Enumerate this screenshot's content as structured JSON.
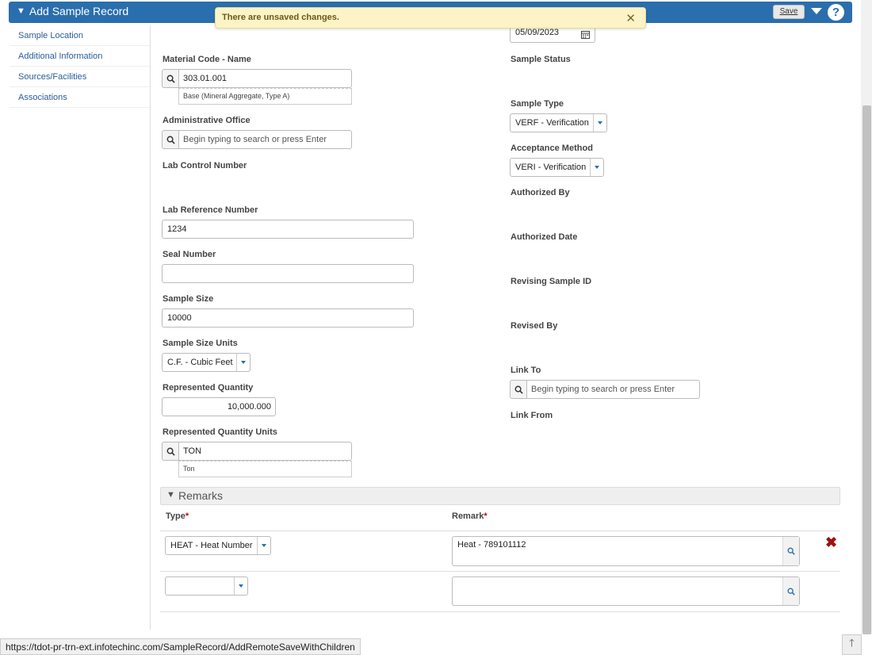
{
  "header": {
    "title": "Add Sample Record",
    "save_label": "Save",
    "help_label": "?"
  },
  "toast": {
    "message": "There are unsaved changes.",
    "close": "✕"
  },
  "sidebar": {
    "items": [
      {
        "label": "Sample Location"
      },
      {
        "label": "Additional Information"
      },
      {
        "label": "Sources/Facilities"
      },
      {
        "label": "Associations"
      }
    ]
  },
  "left": {
    "material_code": {
      "label": "Material Code - Name",
      "value": "303.01.001",
      "desc": "Base (Mineral Aggregate, Type A)"
    },
    "admin_office": {
      "label": "Administrative Office",
      "placeholder": "Begin typing to search or press Enter"
    },
    "lab_control": {
      "label": "Lab Control Number"
    },
    "lab_reference": {
      "label": "Lab Reference Number",
      "value": "1234"
    },
    "seal_number": {
      "label": "Seal Number",
      "value": ""
    },
    "sample_size": {
      "label": "Sample Size",
      "value": "10000"
    },
    "sample_size_units": {
      "label": "Sample Size Units",
      "value": "C.F. - Cubic Feet"
    },
    "represented_qty": {
      "label": "Represented Quantity",
      "value": "10,000.000"
    },
    "represented_qty_units": {
      "label": "Represented Quantity Units",
      "value": "TON",
      "desc": "Ton"
    }
  },
  "right": {
    "date_value": "05/09/2023",
    "sample_status": {
      "label": "Sample Status"
    },
    "sample_type": {
      "label": "Sample Type",
      "value": "VERF - Verification"
    },
    "acceptance_method": {
      "label": "Acceptance Method",
      "value": "VERI - Verification"
    },
    "authorized_by": {
      "label": "Authorized By"
    },
    "authorized_date": {
      "label": "Authorized Date"
    },
    "revising_sample_id": {
      "label": "Revising Sample ID"
    },
    "revised_by": {
      "label": "Revised By"
    },
    "link_to": {
      "label": "Link To",
      "placeholder": "Begin typing to search or press Enter"
    },
    "link_from": {
      "label": "Link From"
    }
  },
  "remarks": {
    "title": "Remarks",
    "type_header": "Type",
    "remark_header": "Remark",
    "required_mark": "*",
    "rows": [
      {
        "type": "HEAT - Heat Number",
        "remark": "Heat - 789101112"
      },
      {
        "type": "",
        "remark": ""
      }
    ]
  },
  "status_bar": {
    "url": "https://tdot-pr-trn-ext.infotechinc.com/SampleRecord/AddRemoteSaveWithChildren"
  },
  "colors": {
    "header_bg": "#2a6ead",
    "toast_bg": "#fcf3c6",
    "link": "#2a5d95",
    "required": "#cc0000",
    "delete": "#a01010"
  }
}
